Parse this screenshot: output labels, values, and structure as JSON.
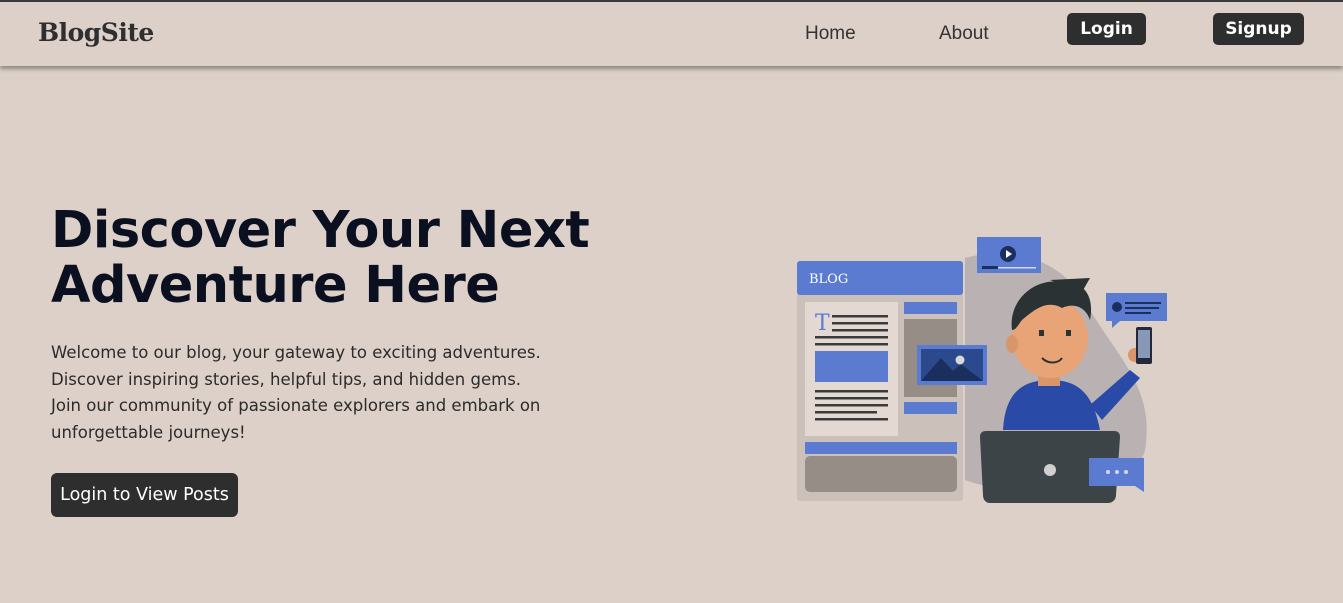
{
  "nav": {
    "logo": "BlogSite",
    "links": [
      {
        "label": "Home"
      },
      {
        "label": "About"
      }
    ],
    "login_label": "Login",
    "signup_label": "Signup"
  },
  "hero": {
    "title_line1": "Discover Your Next",
    "title_line2": "Adventure Here",
    "description": "Welcome to our blog, your gateway to exciting adventures. Discover inspiring stories, helpful tips, and hidden gems. Join our community of passionate explorers and embark on unforgettable journeys!",
    "cta_label": "Login to View Posts"
  },
  "illustration": {
    "blog_label": "BLOG",
    "text_icon_glyph": "T"
  },
  "colors": {
    "background": "#dcd0c8",
    "button": "#2e2e2e",
    "accent_blue": "#5b7bd1",
    "heading": "#0b1020"
  }
}
